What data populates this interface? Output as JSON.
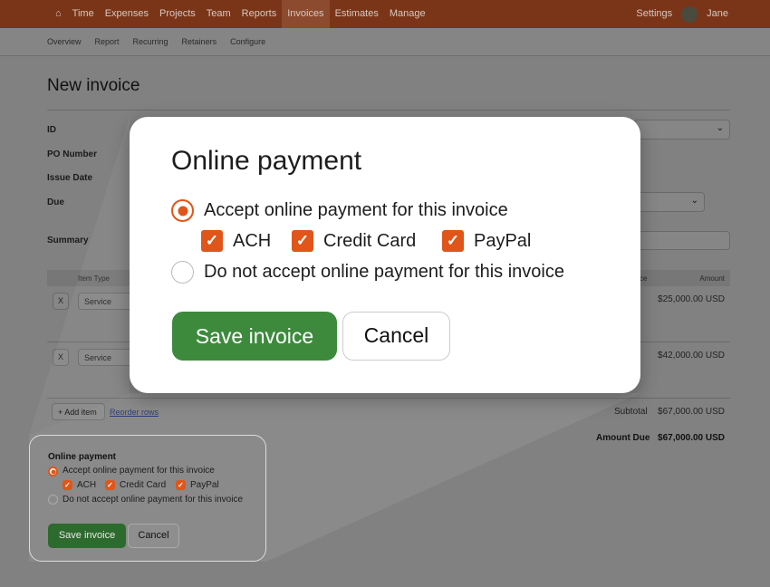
{
  "nav": {
    "items": [
      "Time",
      "Expenses",
      "Projects",
      "Team",
      "Reports",
      "Invoices",
      "Estimates",
      "Manage"
    ],
    "active": "Invoices",
    "settings": "Settings",
    "user": "Jane"
  },
  "subnav": [
    "Overview",
    "Report",
    "Recurring",
    "Retainers",
    "Configure"
  ],
  "page": {
    "title": "New invoice",
    "labels": {
      "id": "ID",
      "po": "PO Number",
      "issue": "Issue Date",
      "due": "Due",
      "summary": "Summary"
    }
  },
  "table": {
    "headers": {
      "item_type": "Item Type",
      "price": "ce",
      "amount": "Amount"
    },
    "rows": [
      {
        "remove": "X",
        "type": "Service",
        "amount": "$25,000.00 USD"
      },
      {
        "remove": "X",
        "type": "Service",
        "amount": "$42,000.00 USD"
      }
    ],
    "add_item": "+ Add item",
    "reorder": "Reorder rows",
    "subtotal_label": "Subtotal",
    "subtotal": "$67,000.00 USD",
    "due_label": "Amount Due",
    "due": "$67,000.00 USD"
  },
  "payment": {
    "title": "Online payment",
    "accept": "Accept online payment for this invoice",
    "methods": [
      "ACH",
      "Credit Card",
      "PayPal"
    ],
    "decline": "Do not accept online payment for this invoice",
    "accept_selected": true,
    "methods_checked": [
      true,
      true,
      true
    ],
    "save": "Save invoice",
    "cancel": "Cancel"
  },
  "colors": {
    "accent": "#e0561a",
    "save": "#3d8a3d",
    "nav": "#f36c23"
  }
}
